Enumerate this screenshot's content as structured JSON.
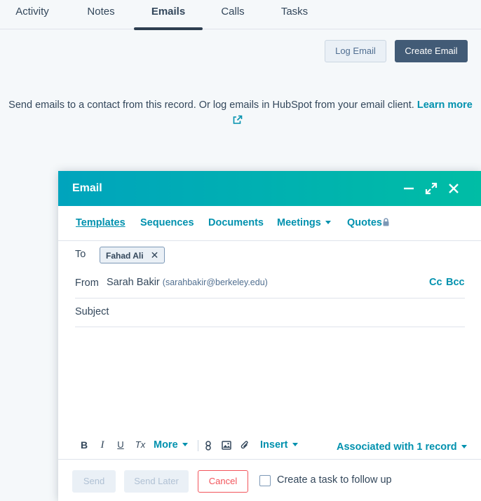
{
  "tabs": [
    {
      "label": "Activity",
      "active": false
    },
    {
      "label": "Notes",
      "active": false
    },
    {
      "label": "Emails",
      "active": true
    },
    {
      "label": "Calls",
      "active": false
    },
    {
      "label": "Tasks",
      "active": false
    }
  ],
  "actions": {
    "log_email": "Log Email",
    "create_email": "Create Email"
  },
  "info": {
    "text": "Send emails to a contact from this record. Or log emails in HubSpot from your email client.",
    "learn_more": "Learn more",
    "external_icon": "external-link-icon"
  },
  "email_modal": {
    "title": "Email",
    "header_icons": [
      "minimize-icon",
      "expand-icon",
      "close-icon"
    ],
    "toolbar": {
      "templates": "Templates",
      "sequences": "Sequences",
      "documents": "Documents",
      "meetings": "Meetings",
      "quotes": "Quotes",
      "quotes_icon": "lock-icon"
    },
    "to": {
      "label": "To",
      "recipient": "Fahad Ali"
    },
    "from": {
      "label": "From",
      "name": "Sarah Bakir",
      "email": "(sarahbakir@berkeley.edu)",
      "cc": "Cc",
      "bcc": "Bcc"
    },
    "subject": {
      "label": "Subject",
      "value": ""
    },
    "body": "",
    "format_toolbar": {
      "bold": "B",
      "italic": "I",
      "underline": "U",
      "clear_format": "Tx",
      "more": "More",
      "insert": "Insert",
      "icons": [
        "bold-icon",
        "italic-icon",
        "underline-icon",
        "clear-format-icon",
        "link-icon",
        "image-icon",
        "attachment-icon"
      ],
      "associated": "Associated with 1 record"
    },
    "footer": {
      "send": "Send",
      "send_later": "Send Later",
      "cancel": "Cancel",
      "follow_up_label": "Create a task to follow up",
      "follow_up_checked": false
    }
  },
  "colors": {
    "accent": "#0091ae",
    "header_gradient_start": "#00a4bd",
    "header_gradient_end": "#00bda5",
    "primary_button": "#425b76",
    "cancel": "#f2545b",
    "text": "#33475b"
  }
}
